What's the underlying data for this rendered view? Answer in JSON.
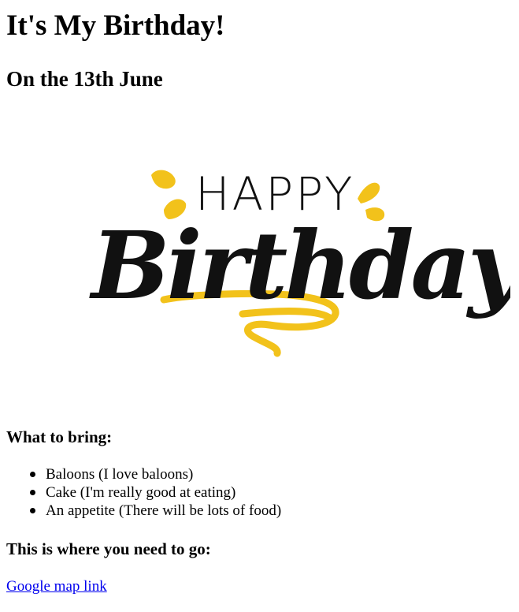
{
  "page": {
    "title": "It's My Birthday!",
    "subtitle": "On the 13th June"
  },
  "banner": {
    "happy_text": "HAPPY",
    "birthday_text": "Birthday",
    "colors": {
      "ink": "#111111",
      "accent": "#f2c21b"
    }
  },
  "bring": {
    "heading": "What to bring:",
    "items": [
      "Baloons (I love baloons)",
      "Cake (I'm really good at eating)",
      "An appetite (There will be lots of food)"
    ]
  },
  "directions": {
    "heading": "This is where you need to go:",
    "link_label": "Google map link"
  }
}
